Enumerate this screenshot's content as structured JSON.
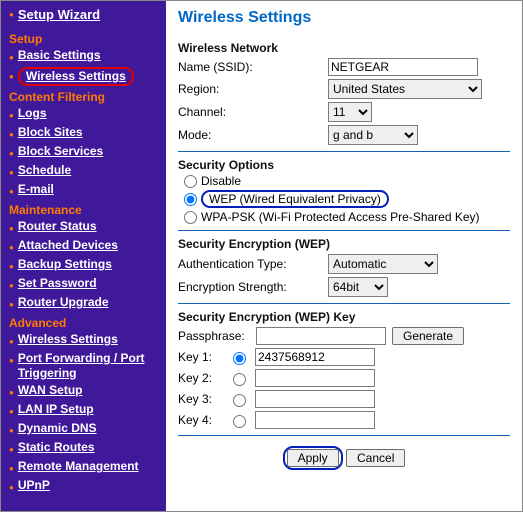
{
  "sidebar": {
    "wizard": "Setup Wizard",
    "sections": [
      {
        "head": "Setup",
        "items": [
          "Basic Settings",
          "Wireless Settings"
        ],
        "selected": 1
      },
      {
        "head": "Content Filtering",
        "items": [
          "Logs",
          "Block Sites",
          "Block Services",
          "Schedule",
          "E-mail"
        ]
      },
      {
        "head": "Maintenance",
        "items": [
          "Router Status",
          "Attached Devices",
          "Backup Settings",
          "Set Password",
          "Router Upgrade"
        ]
      },
      {
        "head": "Advanced",
        "items": [
          "Wireless Settings",
          "Port Forwarding / Port Triggering",
          "WAN Setup",
          "LAN IP Setup",
          "Dynamic DNS",
          "Static Routes",
          "Remote Management",
          "UPnP"
        ]
      }
    ]
  },
  "page_title": "Wireless Settings",
  "wireless_network": {
    "title": "Wireless Network",
    "ssid_label": "Name (SSID):",
    "ssid_value": "NETGEAR",
    "region_label": "Region:",
    "region_value": "United States",
    "channel_label": "Channel:",
    "channel_value": "11",
    "mode_label": "Mode:",
    "mode_value": "g and b"
  },
  "security_options": {
    "title": "Security Options",
    "disable": "Disable",
    "wep": "WEP (Wired Equivalent Privacy)",
    "wpa": "WPA-PSK (Wi-Fi Protected Access Pre-Shared Key)",
    "selected": "wep"
  },
  "wep_section": {
    "title": "Security Encryption (WEP)",
    "auth_label": "Authentication Type:",
    "auth_value": "Automatic",
    "strength_label": "Encryption Strength:",
    "strength_value": "64bit"
  },
  "wep_key_section": {
    "title": "Security Encryption (WEP) Key",
    "pass_label": "Passphrase:",
    "pass_value": "",
    "generate": "Generate",
    "keys": [
      {
        "label": "Key 1:",
        "selected": true,
        "value": "2437568912"
      },
      {
        "label": "Key 2:",
        "selected": false,
        "value": ""
      },
      {
        "label": "Key 3:",
        "selected": false,
        "value": ""
      },
      {
        "label": "Key 4:",
        "selected": false,
        "value": ""
      }
    ]
  },
  "buttons": {
    "apply": "Apply",
    "cancel": "Cancel"
  }
}
